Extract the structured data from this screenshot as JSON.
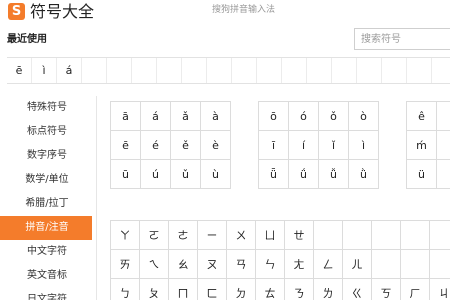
{
  "header": {
    "logo_glyph": "S",
    "title": "符号大全",
    "subtitle": "搜狗拼音输入法"
  },
  "recent": {
    "label": "最近使用",
    "items": [
      "ē",
      "ì",
      "á",
      "",
      "",
      "",
      "",
      "",
      "",
      "",
      "",
      "",
      "",
      "",
      "",
      "",
      ""
    ]
  },
  "search": {
    "placeholder": "搜索符号"
  },
  "sidebar": {
    "items": [
      {
        "label": "特殊符号"
      },
      {
        "label": "标点符号"
      },
      {
        "label": "数字序号"
      },
      {
        "label": "数学/单位"
      },
      {
        "label": "希腊/拉丁"
      },
      {
        "label": "拼音/注音",
        "active": true
      },
      {
        "label": "中文字符"
      },
      {
        "label": "英文音标"
      },
      {
        "label": "日文字符"
      }
    ]
  },
  "pinyin": {
    "group_a": [
      "ā",
      "á",
      "ǎ",
      "à",
      "ē",
      "é",
      "ě",
      "è",
      "ū",
      "ú",
      "ǔ",
      "ù"
    ],
    "group_o": [
      "ō",
      "ó",
      "ǒ",
      "ò",
      "ī",
      "í",
      "ǐ",
      "ì",
      "ǖ",
      "ǘ",
      "ǚ",
      "ǜ"
    ],
    "group_e": [
      "ê",
      "",
      "ḿ",
      "",
      "ü",
      ""
    ],
    "zhuyin": [
      "ㄚ",
      "ㄛ",
      "ㄜ",
      "ㄧ",
      "ㄨ",
      "ㄩ",
      "ㄝ",
      "",
      "",
      "",
      "",
      "",
      "ㄞ",
      "ㄟ",
      "ㄠ",
      "ㄡ",
      "ㄢ",
      "ㄣ",
      "ㄤ",
      "ㄥ",
      "ㄦ",
      "",
      "",
      "",
      "ㄅ",
      "ㄆ",
      "ㄇ",
      "ㄈ",
      "ㄉ",
      "ㄊ",
      "ㄋ",
      "ㄌ",
      "ㄍ",
      "ㄎ",
      "ㄏ",
      "ㄐ"
    ]
  },
  "colors": {
    "accent": "#f47c2b"
  }
}
